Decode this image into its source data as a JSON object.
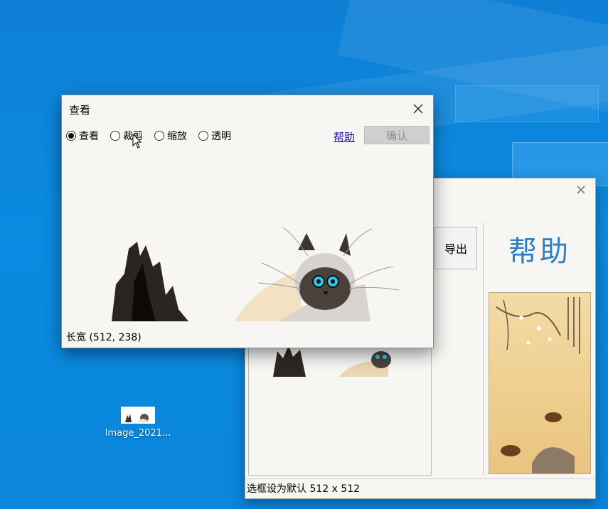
{
  "desktop": {
    "icon_label": "Image_2021..."
  },
  "front_window": {
    "title": "查看",
    "modes": [
      "查看",
      "裁剪",
      "缩放",
      "透明"
    ],
    "selected_mode": "查看",
    "help_link": "帮助",
    "confirm_button": "确认",
    "status": "长宽 (512, 238)"
  },
  "back_window": {
    "export_button": "导出",
    "help_logo": "帮助",
    "status": "选框设为默认 512 x 512"
  },
  "colors": {
    "desktop_blue": "#0a86dc",
    "window_bg": "#f7f6f3",
    "link_blue": "#1a0dab",
    "disabled_button": "#cfcfcf",
    "help_logo_blue": "#2a7fc6"
  },
  "icons": [
    "close-icon",
    "radio-icon",
    "cursor-icon",
    "image-file-icon"
  ]
}
